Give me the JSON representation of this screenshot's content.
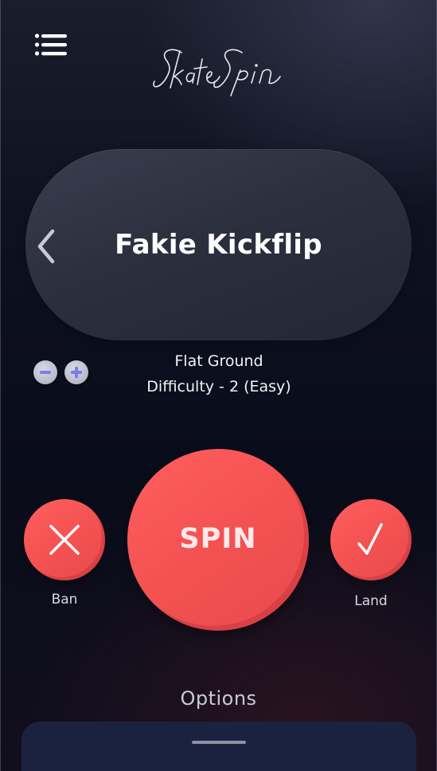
{
  "app": {
    "logo_text": "Skate Spin"
  },
  "header": {
    "menu_icon": "hamburger-menu-icon"
  },
  "trick": {
    "name": "Fakie Kickflip",
    "stance": "Flat Ground",
    "difficulty": "Difficulty - 2 (Easy)",
    "prev_icon": "chevron-left-icon"
  },
  "difficulty_controls": {
    "decrease_icon": "minus-icon",
    "increase_icon": "plus-icon"
  },
  "actions": {
    "spin_label": "SPIN",
    "ban_label": "Ban",
    "ban_icon": "close-x-icon",
    "land_label": "Land",
    "land_icon": "checkmark-icon"
  },
  "options": {
    "title": "Options"
  },
  "colors": {
    "accent": "#f35151",
    "card": "#2f3242",
    "sheet": "#1b2240",
    "control_icon": "#7b7ee6"
  }
}
